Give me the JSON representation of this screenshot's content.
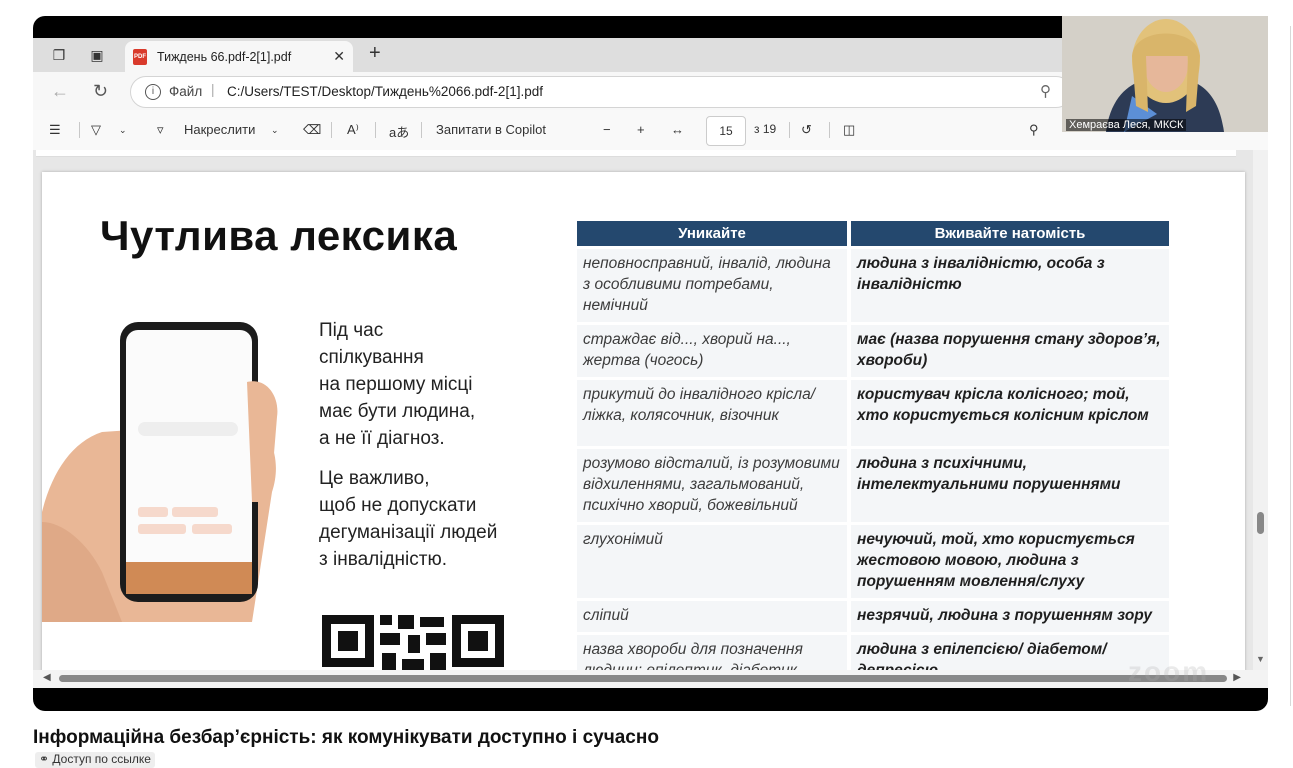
{
  "browser": {
    "tab": {
      "title": "Тиждень 66.pdf-2[1].pdf"
    },
    "address": {
      "scheme_label": "Файл",
      "url": "C:/Users/TEST/Desktop/Тиждень%2066.pdf-2[1].pdf"
    }
  },
  "pdf_toolbar": {
    "draw_label": "Накреслити",
    "read_aloud_glyph": "A⁾",
    "translate_glyph": "aあ",
    "copilot_label": "Запитати в Copilot",
    "page_current": "15",
    "page_total": "з 19"
  },
  "slide": {
    "title": "Чутлива лексика",
    "paragraphs": [
      "Під час\nспілкування\nна першому місці\nмає бути людина,\nа не її діагноз.",
      "Це важливо,\nщоб не допускати\nдегуманізації людей\nз інвалідністю."
    ],
    "table": {
      "headers": [
        "Уникайте",
        "Вживайте натомість"
      ],
      "rows": [
        [
          "неповносправний, інвалід, людина з особливими потребами, немічний",
          "людина з інвалідністю, особа з інвалідністю"
        ],
        [
          "страждає від..., хворий на..., жертва (чогось)",
          "має (назва порушення стану здоров’я, хвороби)"
        ],
        [
          "прикутий до інвалідного крісла/ ліжка, колясочник, візочник",
          "користувач крісла колісного; той, хто користується колісним кріслом"
        ],
        [
          "розумово відсталий, із розумовими відхиленнями, загальмований, психічно хворий, божевільний",
          "людина з психічними, інтелектуальними порушеннями"
        ],
        [
          "глухонімий",
          "нечуючий, той, хто користується жестовою мовою, людина з порушенням мовлення/слуху"
        ],
        [
          "сліпий",
          "незрячий, людина з порушенням зору"
        ],
        [
          "назва хвороби для позначення людини: епілептик, діабетик",
          "людина з епілепсією/ діабетом/депресією"
        ]
      ]
    }
  },
  "webcam": {
    "name": "Хемраєва Леся, МКСК"
  },
  "watermark": "zoom",
  "video": {
    "title": "Інформаційна безбар’єрність: як комунікувати доступно і сучасно",
    "access_label": "Доступ по ссылке"
  }
}
